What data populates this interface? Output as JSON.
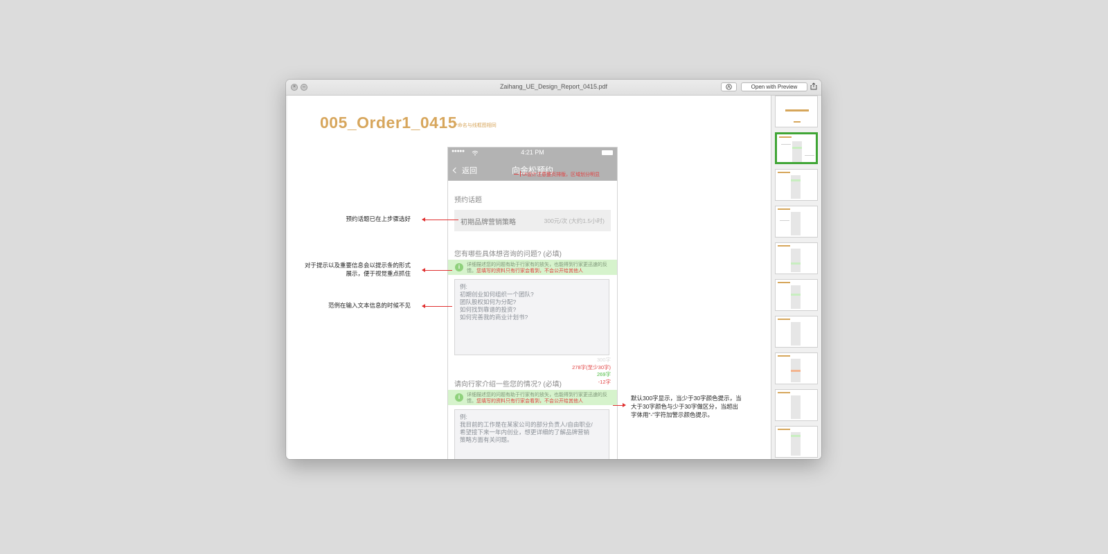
{
  "window": {
    "title": "Zaihang_UE_Design_Report_0415.pdf",
    "open_with_label": "Open with Preview"
  },
  "page": {
    "heading": "005_Order1_0415",
    "heading_note": "*命名与线框图相同"
  },
  "phone": {
    "status": {
      "signal": "●●●●●",
      "time": "4:21 PM"
    },
    "nav": {
      "back_label": "返回",
      "title": "向金松预约",
      "note": "UI设计注意整页排版，区域划分明显"
    },
    "topic_section": {
      "title": "预约话题",
      "topic_name": "初期品牌营销策略",
      "topic_price": "300元/次 (大约1.5小时)"
    },
    "question_section": {
      "title": "您有哪些具体想咨询的问题? (必填)",
      "tip_normal": "详细描述您的问题有助于行家有的放矢，也能得到行家更迅速的反馈。",
      "tip_red": "您填写的资料只有行家会看到，不会公开给其他人",
      "placeholder_lines": [
        "例:",
        "初期创业如何组织一个团队?",
        "团队股权如何为分配?",
        "如何找到靠谱的投资?",
        "如何完善我的商业计划书?"
      ],
      "counters": [
        "300字",
        "278字(至少30字)",
        "269字",
        "-12字"
      ]
    },
    "intro_section": {
      "title": "请向行家介绍一些您的情况? (必填)",
      "tip_normal": "详细描述您的问题有助于行家有的放矢，也能得到行家更迅速的反馈。",
      "tip_red": "您填写的资料只有行家会看到，不会公开给其他人",
      "placeholder_lines": [
        "例:",
        "我目前的工作是在某家公司的部分负责人/自由职业/",
        "希望接下来一年内创业，想更详细的了解品牌营销",
        "策略方面有关问题。"
      ]
    }
  },
  "annotations": {
    "topic": "预约话题已在上步骤选好",
    "tip_lines": [
      "对于提示以及重要信息会以提示条的形式",
      "展示，便于视觉重点抓住"
    ],
    "example": "范例在输入文本信息的时候不见",
    "counter_lines": [
      "默认300字显示，当少于30字颜色提示，当",
      "大于30字颜色与少于30字做区分，当超出",
      "字体用“-”字符加警示颜色提示。"
    ]
  },
  "colors": {
    "heading_gold": "#d7a65c",
    "tip_green": "#d6f3cc",
    "warning_red": "#e04040",
    "selected_thumb": "#3fa535",
    "navbar_gray": "#b3b3b3"
  }
}
